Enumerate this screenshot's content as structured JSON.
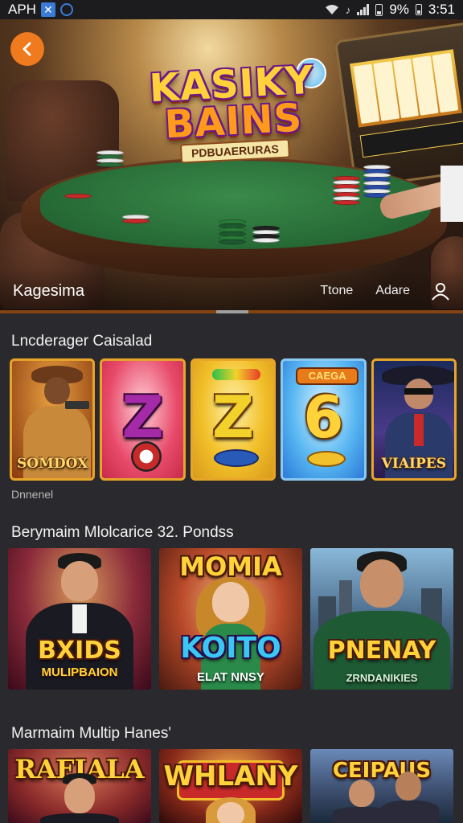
{
  "status_bar": {
    "carrier": "APH",
    "battery": "9%",
    "time": "3:51",
    "icons": [
      "x-app-icon",
      "app-icon",
      "wifi-icon",
      "signal-icon",
      "battery-icon"
    ]
  },
  "hero": {
    "logo_line1": "KASIKY",
    "logo_line2": "BAINS",
    "logo_subtitle": "PDBUAERURAS",
    "brand": "Kagesima",
    "nav_links": [
      "Ttone",
      "Adare"
    ],
    "colors": {
      "accent": "#f07a1e",
      "felt": "#2a7a3a"
    }
  },
  "section1": {
    "title": "Lncderager Caisalad",
    "caption": "Dnnenel",
    "cards": [
      {
        "label": "SOMDOX",
        "kind": "cowboy"
      },
      {
        "label": "",
        "digit": "Z",
        "kind": "digit-pink"
      },
      {
        "label": "",
        "digit": "Z",
        "kind": "digit-gold"
      },
      {
        "label": "",
        "digit": "6",
        "kind": "digit-blue",
        "top_badge": "CAEGA"
      },
      {
        "label": "VIAIPES",
        "kind": "sheriff"
      }
    ]
  },
  "section2": {
    "title": "Berymaim Mlolcarice 32. Pondss",
    "tiles": [
      {
        "title": "BXIDS",
        "subtitle": "MULIPBAION"
      },
      {
        "title": "MOMIA",
        "title2": "KOITO",
        "subtitle": "ELAT NNSY"
      },
      {
        "title": "PNENAY",
        "subtitle": "ZRNDANIKIES"
      }
    ]
  },
  "section3": {
    "title": "Marmaim Multip Hanes'",
    "tiles": [
      {
        "title": "RAFIALA"
      },
      {
        "title": "WHLANY"
      },
      {
        "title": "CEIPAUS"
      }
    ]
  }
}
